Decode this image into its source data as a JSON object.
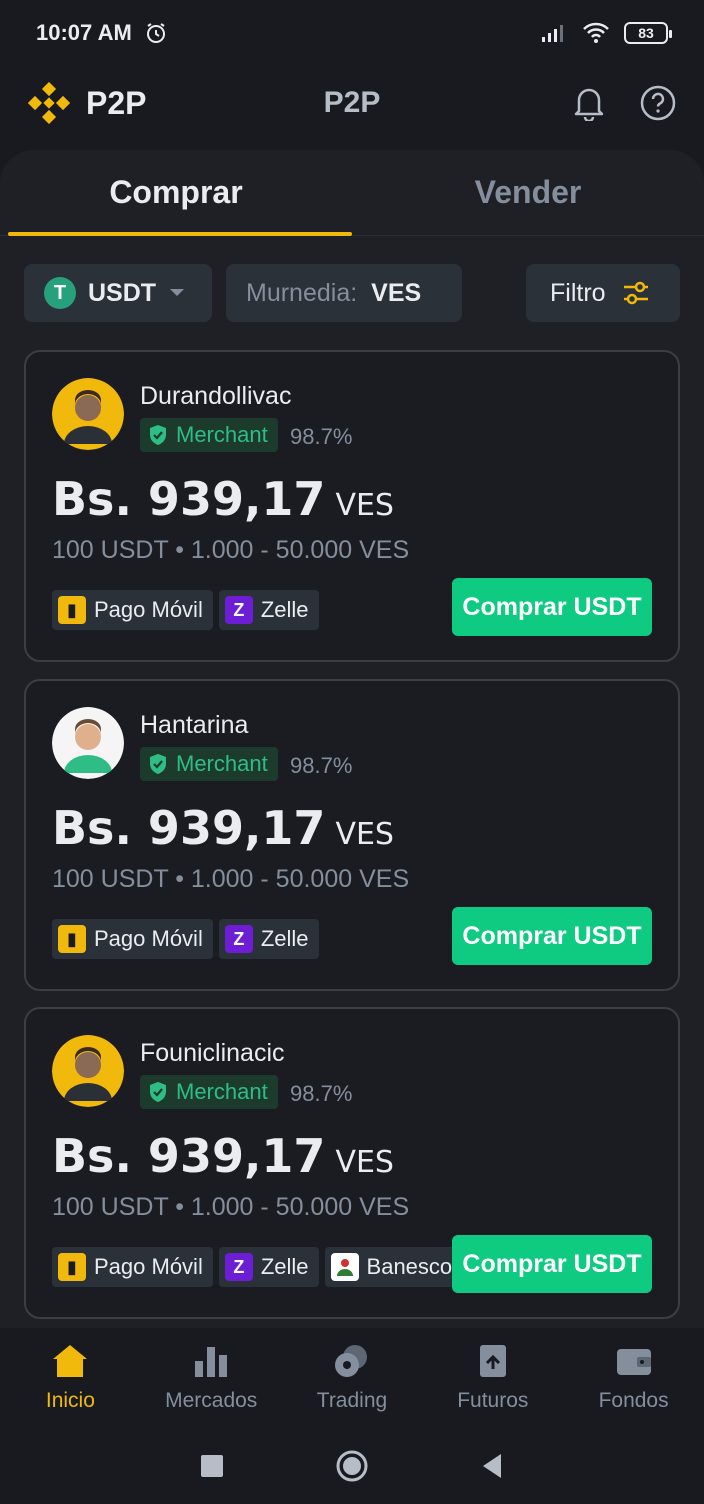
{
  "status_bar": {
    "time": "10:07 AM",
    "battery": "83"
  },
  "header": {
    "brand": "P2P",
    "title": "P2P"
  },
  "tabs": [
    {
      "label": "Comprar",
      "active": true
    },
    {
      "label": "Vender",
      "active": false
    }
  ],
  "filters": {
    "coin": "USDT",
    "currency_label": "Murnedia:",
    "currency_value": "VES",
    "filter_label": "Filtro"
  },
  "offers": [
    {
      "name": "Durandollivac",
      "badge": "Merchant",
      "completion": "98.7%",
      "price": "Bs. 939,17",
      "price_currency": "VES",
      "limits": "100 USDT • 1.000 - 50.000 VES",
      "methods": [
        "Pago Móvil",
        "Zelle"
      ],
      "button": "Comprar USDT"
    },
    {
      "name": "Hantarina",
      "badge": "Merchant",
      "completion": "98.7%",
      "price": "Bs. 939,17",
      "price_currency": "VES",
      "limits": "100 USDT • 1.000 - 50.000 VES",
      "methods": [
        "Pago Móvil",
        "Zelle"
      ],
      "button": "Comprar USDT"
    },
    {
      "name": "Founiclinacic",
      "badge": "Merchant",
      "completion": "98.7%",
      "price": "Bs. 939,17",
      "price_currency": "VES",
      "limits": "100 USDT • 1.000 - 50.000 VES",
      "methods": [
        "Pago Móvil",
        "Zelle",
        "Banesco"
      ],
      "button": "Comprar USDT"
    }
  ],
  "bottom_nav": [
    {
      "label": "Inicio",
      "icon": "home-icon",
      "active": true
    },
    {
      "label": "Mercados",
      "icon": "bar-chart-icon",
      "active": false
    },
    {
      "label": "Trading",
      "icon": "trading-icon",
      "active": false
    },
    {
      "label": "Futuros",
      "icon": "futures-icon",
      "active": false
    },
    {
      "label": "Fondos",
      "icon": "wallet-icon",
      "active": false
    }
  ],
  "colors": {
    "accent": "#f0b90b",
    "buy": "#0ecb81",
    "background": "#181a20",
    "merchant": "#2ebd85"
  }
}
